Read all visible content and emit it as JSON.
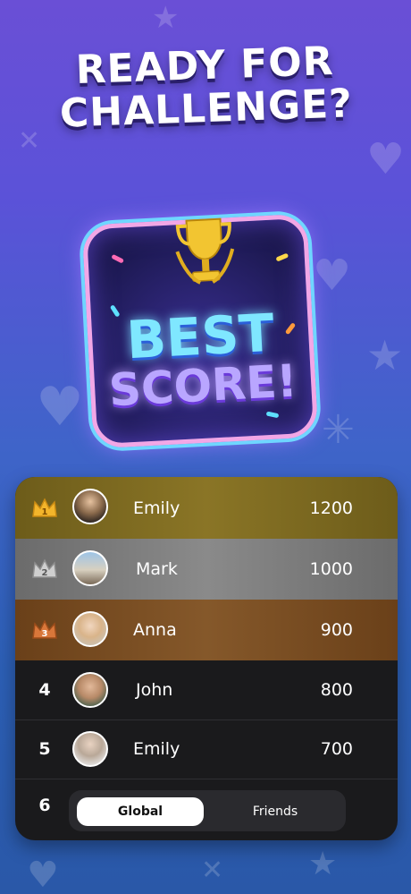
{
  "headline": {
    "line1": "READY FOR",
    "line2": "CHALLENGE?"
  },
  "badge": {
    "line1": "BEST",
    "line2": "SCORE!",
    "icon": "trophy-icon"
  },
  "colors": {
    "gold_row": "#7d6a1f",
    "silver_row": "#7a7a7a",
    "bronze_row": "#7a4d22",
    "board_bg": "#1a1a1c",
    "background_top": "#6a4fd6",
    "background_bottom": "#2a58a8"
  },
  "leaderboard": {
    "rows": [
      {
        "rank": "1",
        "name": "Emily",
        "score": "1200",
        "medal": "gold-crown-icon"
      },
      {
        "rank": "2",
        "name": "Mark",
        "score": "1000",
        "medal": "silver-crown-icon"
      },
      {
        "rank": "3",
        "name": "Anna",
        "score": "900",
        "medal": "bronze-crown-icon"
      },
      {
        "rank": "4",
        "name": "John",
        "score": "800"
      },
      {
        "rank": "5",
        "name": "Emily",
        "score": "700"
      },
      {
        "rank": "6"
      }
    ]
  },
  "tabs": {
    "global": "Global",
    "friends": "Friends",
    "selected": "Global"
  }
}
